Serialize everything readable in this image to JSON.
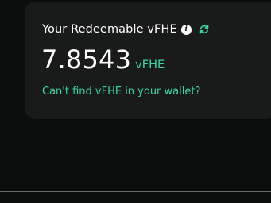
{
  "card": {
    "title": "Your Redeemable vFHE",
    "info_icon": "info-icon",
    "refresh_icon": "refresh-icon",
    "balance": "7.8543",
    "balance_unit": "vFHE",
    "wallet_link": "Can't find vFHE in your wallet?"
  },
  "colors": {
    "background": "#0b0d0c",
    "card_background": "#181b1a",
    "accent": "#3ed6a4",
    "text": "#ffffff"
  }
}
